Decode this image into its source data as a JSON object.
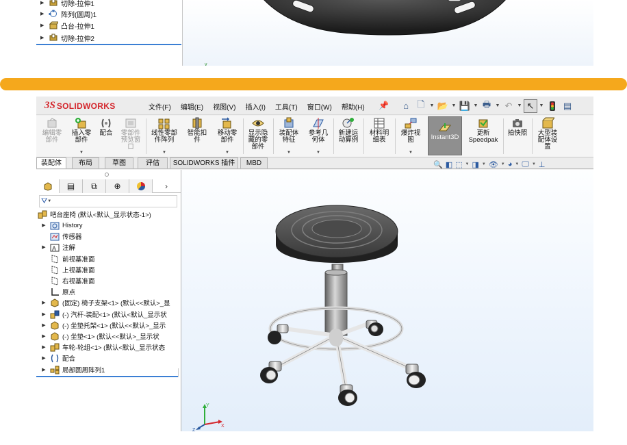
{
  "top_tree": {
    "items": [
      {
        "label": "切除-拉伸1",
        "icon": "cut-extrude-icon"
      },
      {
        "label": "阵列(圆周)1",
        "icon": "circular-pattern-icon"
      },
      {
        "label": "凸台-拉伸1",
        "icon": "boss-extrude-icon"
      },
      {
        "label": "切除-拉伸2",
        "icon": "cut-extrude-icon"
      }
    ]
  },
  "menubar": {
    "logo_ds": "3S",
    "logo_text": "SOLIDWORKS",
    "menus": [
      "文件(F)",
      "编辑(E)",
      "视图(V)",
      "插入(I)",
      "工具(T)",
      "窗口(W)",
      "帮助(H)"
    ]
  },
  "ribbon": {
    "buttons": [
      {
        "label": "编辑零\n部件",
        "icon": "edit-component-icon",
        "disabled": true
      },
      {
        "label": "插入零\n部件",
        "icon": "insert-component-icon",
        "disabled": false
      },
      {
        "label": "配合",
        "icon": "mate-icon",
        "disabled": false
      },
      {
        "label": "零部件\n预览窗\n口",
        "icon": "component-preview-icon",
        "disabled": true
      },
      {
        "label": "线性零部\n件阵列",
        "icon": "linear-pattern-icon",
        "disabled": false
      },
      {
        "label": "智能扣\n件",
        "icon": "smart-fastener-icon",
        "disabled": false
      },
      {
        "label": "移动零\n部件",
        "icon": "move-component-icon",
        "disabled": false
      },
      {
        "label": "显示隐\n藏的零\n部件",
        "icon": "show-hidden-icon",
        "disabled": false
      },
      {
        "label": "装配体\n特征",
        "icon": "assembly-feature-icon",
        "disabled": false
      },
      {
        "label": "参考几\n何体",
        "icon": "reference-geometry-icon",
        "disabled": false
      },
      {
        "label": "新建运\n动算例",
        "icon": "motion-study-icon",
        "disabled": false
      },
      {
        "label": "材料明\n细表",
        "icon": "bom-icon",
        "disabled": false
      },
      {
        "label": "爆炸视\n图",
        "icon": "exploded-view-icon",
        "disabled": false
      },
      {
        "label": "Instant3D",
        "icon": "instant3d-icon",
        "disabled": false
      },
      {
        "label": "更新\nSpeedpak",
        "icon": "speedpak-icon",
        "disabled": false
      },
      {
        "label": "拍快照",
        "icon": "snapshot-icon",
        "disabled": false
      },
      {
        "label": "大型装\n配体设\n置",
        "icon": "large-assembly-icon",
        "disabled": false
      }
    ]
  },
  "tabs": [
    "装配体",
    "布局",
    "草图",
    "评估",
    "SOLIDWORKS 插件",
    "MBD"
  ],
  "feature_tree": {
    "root": "吧台座椅 (默认<默认_显示状态-1>)",
    "items": [
      {
        "label": "History",
        "icon": "history-icon",
        "arrow": true
      },
      {
        "label": "传感器",
        "icon": "sensor-icon",
        "arrow": false
      },
      {
        "label": "注解",
        "icon": "annotation-icon",
        "arrow": true
      },
      {
        "label": "前视基准面",
        "icon": "plane-icon",
        "arrow": false
      },
      {
        "label": "上视基准面",
        "icon": "plane-icon",
        "arrow": false
      },
      {
        "label": "右视基准面",
        "icon": "plane-icon",
        "arrow": false
      },
      {
        "label": "原点",
        "icon": "origin-icon",
        "arrow": false
      },
      {
        "label": "(固定) 椅子支架<1> (默认<<默认>_显",
        "icon": "part-icon",
        "arrow": true
      },
      {
        "label": "(-) 汽杆-装配<1> (默认<默认_显示状",
        "icon": "subassembly-icon",
        "arrow": true
      },
      {
        "label": "(-) 坐垫托架<1> (默认<<默认>_显示",
        "icon": "part-icon",
        "arrow": true
      },
      {
        "label": "(-) 坐垫<1> (默认<<默认>_显示状",
        "icon": "part-icon",
        "arrow": true
      },
      {
        "label": "车轮-轮组<1> (默认<默认_显示状态",
        "icon": "subassembly-icon",
        "arrow": true
      },
      {
        "label": "配合",
        "icon": "mates-folder-icon",
        "arrow": true
      },
      {
        "label": "局部圆周阵列1",
        "icon": "pattern-icon",
        "arrow": true
      }
    ]
  },
  "colors": {
    "divider": "#f5a81c",
    "accent_blue": "#3b7fd4",
    "logo_red": "#d4262c"
  }
}
